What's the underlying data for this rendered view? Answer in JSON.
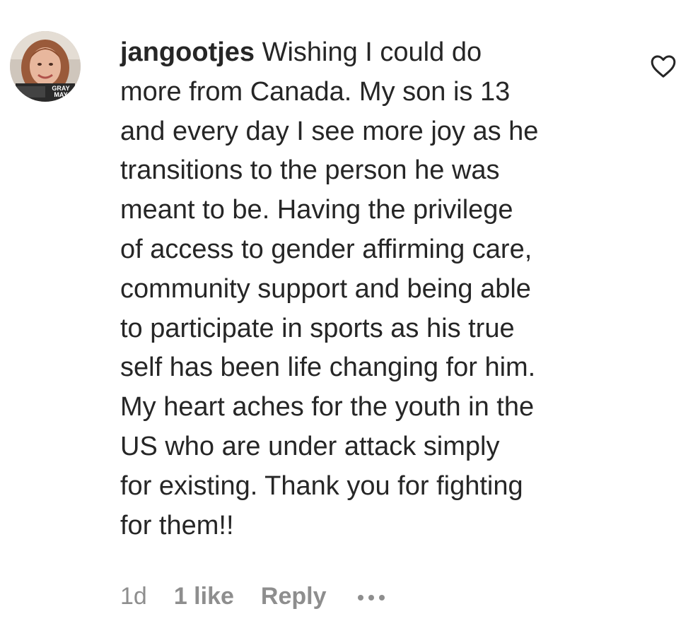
{
  "comment": {
    "username": "jangootjes",
    "lines": [
      " Wishing I could do",
      "more from Canada. My son is 13",
      "and every day I see more joy as he",
      "transitions to the person he was",
      "meant to be. Having the privilege",
      "of access to gender affirming care,",
      "community support and being able",
      "to participate in sports as his true",
      "self has been life changing for him.",
      "My heart aches for the youth in the",
      "US who are under attack simply",
      "for existing. Thank you for fighting",
      "for them!!"
    ],
    "avatar_text_1": "GRAY",
    "avatar_text_2": "MAY",
    "time": "1d",
    "likes": "1 like",
    "reply_label": "Reply",
    "like_icon": "heart-outline-icon",
    "more_icon": "more-options-icon"
  },
  "colors": {
    "text": "#262626",
    "secondary": "#8e8e8e",
    "background": "#ffffff"
  }
}
